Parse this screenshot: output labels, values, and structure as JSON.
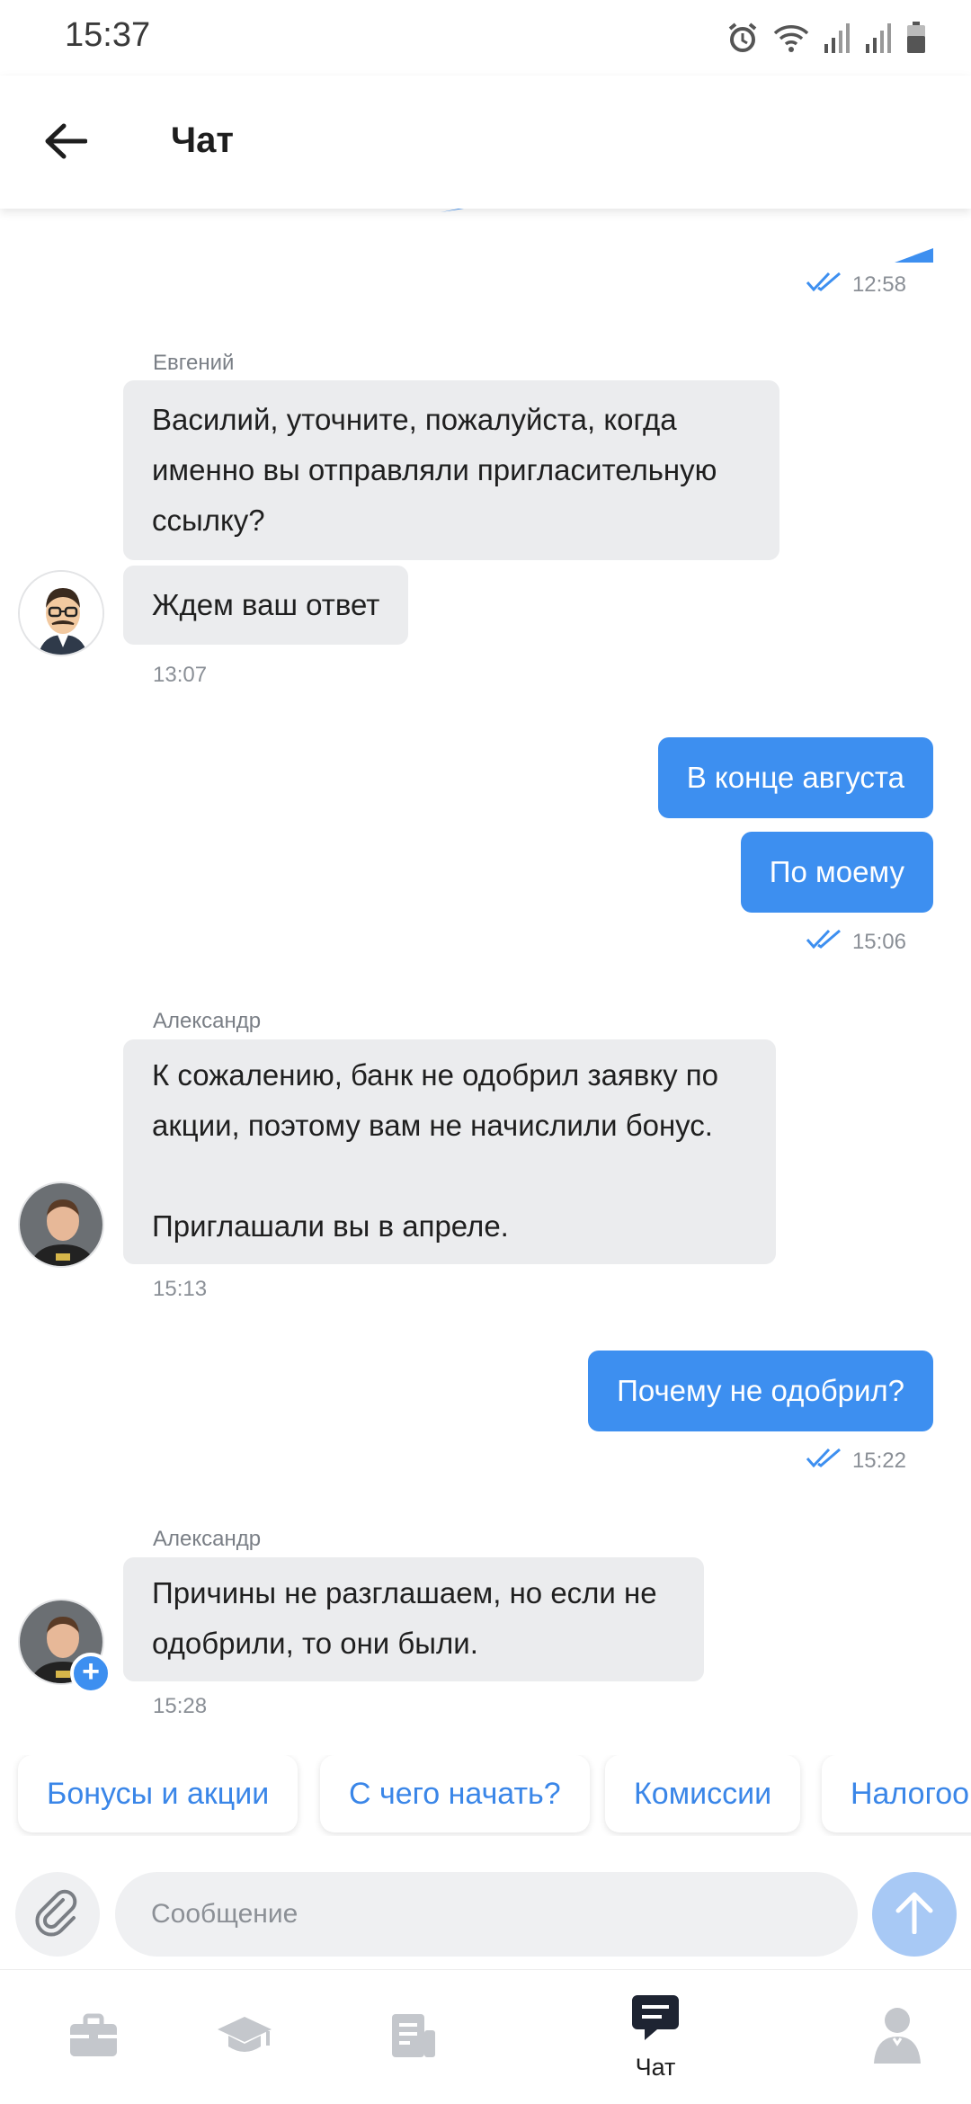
{
  "status_bar": {
    "time": "15:37",
    "icons": [
      "alarm-icon",
      "wifi-icon",
      "signal-icon",
      "signal-icon",
      "battery-icon"
    ]
  },
  "header": {
    "back_icon": "arrow-left-icon",
    "title": "Чат"
  },
  "messages": [
    {
      "direction": "out",
      "time": "12:58",
      "status_icon": "double-check-icon"
    },
    {
      "direction": "in",
      "sender": "Евгений",
      "avatar_icon": "mustache-avatar-icon",
      "bubbles": [
        "Василий, уточните, пожалуйста, когда\nименно вы отправляли пригласительную\nссылку?",
        "Ждем ваш ответ"
      ],
      "time": "13:07"
    },
    {
      "direction": "out",
      "bubbles": [
        "В конце августа",
        "По моему"
      ],
      "time": "15:06",
      "status_icon": "double-check-icon"
    },
    {
      "direction": "in",
      "sender": "Александр",
      "avatar_icon": "person-avatar-icon",
      "bubbles": [
        "К сожалению, банк не одобрил заявку по\nакции, поэтому вам не начислили бонус.\n\nПриглашали вы в апреле."
      ],
      "time": "15:13"
    },
    {
      "direction": "out",
      "bubbles": [
        "Почему не одобрил?"
      ],
      "time": "15:22",
      "status_icon": "double-check-icon"
    },
    {
      "direction": "in",
      "sender": "Александр",
      "avatar_icon": "person-avatar-icon",
      "bubbles": [
        "Причины не разглашаем, но если не\nодобрили, то они были."
      ],
      "time": "15:28"
    }
  ],
  "quick_replies": [
    "Бонусы и акции",
    "С чего начать?",
    "Комиссии",
    "Налогоо"
  ],
  "composer": {
    "attach_icon": "paperclip-icon",
    "placeholder": "Сообщение",
    "value": "",
    "send_icon": "arrow-up-icon"
  },
  "bottom_nav": [
    {
      "icon": "briefcase-icon",
      "label": ""
    },
    {
      "icon": "graduation-cap-icon",
      "label": ""
    },
    {
      "icon": "document-icon",
      "label": ""
    },
    {
      "icon": "chat-icon",
      "label": "Чат",
      "active": true
    },
    {
      "icon": "profile-icon",
      "label": ""
    }
  ],
  "colors": {
    "accent": "#3d8ff0",
    "incoming_bubble": "#ebecee",
    "send_button": "#a8c9f5",
    "muted_text": "#8a8f96"
  }
}
